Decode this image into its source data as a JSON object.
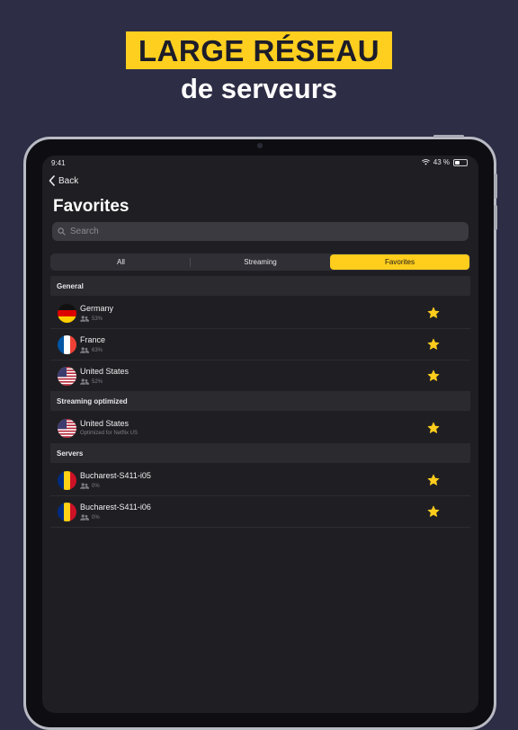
{
  "promo": {
    "headline": "LARGE RÉSEAU",
    "subline": "de serveurs"
  },
  "status_bar": {
    "time": "9:41",
    "battery": "43 %",
    "battery_level": 0.43
  },
  "nav": {
    "back_label": "Back"
  },
  "page": {
    "title": "Favorites"
  },
  "search": {
    "placeholder": "Search"
  },
  "tabs": [
    {
      "label": "All",
      "active": false
    },
    {
      "label": "Streaming",
      "active": false
    },
    {
      "label": "Favorites",
      "active": true
    }
  ],
  "sections": [
    {
      "header": "General",
      "rows": [
        {
          "name": "Germany",
          "sub": "53%",
          "flag": "germany",
          "sub_icon": "users-icon",
          "favorite": true
        },
        {
          "name": "France",
          "sub": "63%",
          "flag": "france",
          "sub_icon": "users-icon",
          "favorite": true
        },
        {
          "name": "United States",
          "sub": "52%",
          "flag": "united-states",
          "sub_icon": "users-icon",
          "favorite": true
        }
      ]
    },
    {
      "header": "Streaming optimized",
      "rows": [
        {
          "name": "United States",
          "sub": "Optimized for Netflix US",
          "flag": "united-states",
          "sub_icon": "",
          "favorite": true
        }
      ]
    },
    {
      "header": "Servers",
      "rows": [
        {
          "name": "Bucharest-S411-i05",
          "sub": "0%",
          "flag": "romania",
          "sub_icon": "users-icon",
          "favorite": true
        },
        {
          "name": "Bucharest-S411-i06",
          "sub": "0%",
          "flag": "romania",
          "sub_icon": "users-icon",
          "favorite": true
        }
      ]
    }
  ],
  "colors": {
    "background": "#2d2d45",
    "accent": "#ffcd1c",
    "screen": "#1f1f23"
  }
}
